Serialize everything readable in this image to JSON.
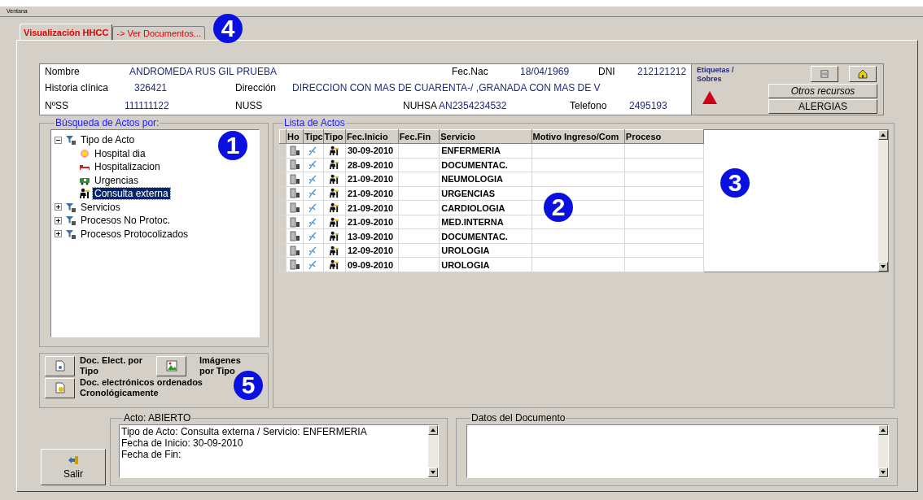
{
  "menu": [
    "Ventana"
  ],
  "tabs": [
    {
      "label": "Visualización HHCC",
      "selected": true
    },
    {
      "label": "-> Ver Documentos...",
      "selected": false
    }
  ],
  "patient": {
    "fields": [
      {
        "label": "Nombre",
        "value": "ANDROMEDA RUS GIL PRUEBA"
      },
      {
        "label": "Fec.Nac",
        "value": "18/04/1969"
      },
      {
        "label": "DNI",
        "value": "212121212"
      },
      {
        "label": "Historia clínica",
        "value": "326421"
      },
      {
        "label": "Dirección",
        "value": "DIRECCION CON MAS DE CUARENTA-/ ,GRANADA CON MAS DE V"
      },
      {
        "label": "NºSS",
        "value": "111111122"
      },
      {
        "label": "NUSS"
      },
      {
        "label": "NUHSA",
        "value": "AN2354234532"
      },
      {
        "label": "Telefono",
        "value": "2495193"
      }
    ]
  },
  "resources": {
    "labels_caption": "Etiquetas / Sobres",
    "other_button": "Otros recursos",
    "allergies_button": "ALERGIAS"
  },
  "search_tree": {
    "title": "Búsqueda de Actos por:",
    "items": [
      {
        "label": "Tipo de Acto",
        "kind": "filter",
        "expanded": true,
        "selected": false,
        "children": [
          {
            "label": "Hospital dia",
            "kind": "sun",
            "selected": false
          },
          {
            "label": "Hospitalizacion",
            "kind": "bed",
            "selected": false
          },
          {
            "label": "Urgencias",
            "kind": "ambulance",
            "selected": false
          },
          {
            "label": "Consulta externa",
            "kind": "doctor",
            "selected": true
          }
        ]
      },
      {
        "label": "Servicios",
        "kind": "filter",
        "expanded": false,
        "selected": false
      },
      {
        "label": "Procesos No Protoc.",
        "kind": "filter",
        "expanded": false,
        "selected": false
      },
      {
        "label": "Procesos Protocolizados",
        "kind": "filter",
        "expanded": false,
        "selected": false
      }
    ]
  },
  "doc_buttons": [
    {
      "label": "Doc. Elect. por Tipo",
      "kind": "doc"
    },
    {
      "label": "Imágenes por Tipo",
      "kind": "image"
    },
    {
      "label": "Doc. electrónicos ordenados Cronológicamente",
      "kind": "chrono"
    }
  ],
  "acts_list": {
    "title": "Lista de Actos",
    "columns": [
      "Ho",
      "Tipc",
      "Tipo",
      "Fec.Inicio",
      "Fec.Fin",
      "Servicio",
      "Motivo Ingreso/Com",
      "Proceso"
    ],
    "rows": [
      {
        "fec_inicio": "30-09-2010",
        "servicio": "ENFERMERIA"
      },
      {
        "fec_inicio": "28-09-2010",
        "servicio": "DOCUMENTAC."
      },
      {
        "fec_inicio": "21-09-2010",
        "servicio": "NEUMOLOGIA"
      },
      {
        "fec_inicio": "21-09-2010",
        "servicio": "URGENCIAS"
      },
      {
        "fec_inicio": "21-09-2010",
        "servicio": "CARDIOLOGIA"
      },
      {
        "fec_inicio": "21-09-2010",
        "servicio": "MED.INTERNA"
      },
      {
        "fec_inicio": "13-09-2010",
        "servicio": "DOCUMENTAC."
      },
      {
        "fec_inicio": "12-09-2010",
        "servicio": "UROLOGIA"
      },
      {
        "fec_inicio": "09-09-2010",
        "servicio": "UROLOGIA"
      }
    ]
  },
  "act": {
    "title": "Acto: ABIERTO",
    "lines": [
      "Tipo de Acto: Consulta externa / Servicio: ENFERMERIA",
      "Fecha de Inicio: 30-09-2010",
      "Fecha de Fin:"
    ]
  },
  "document": {
    "title": "Datos del Documento"
  },
  "exit_button": "Salir",
  "callouts": [
    {
      "label": "1"
    },
    {
      "label": "2"
    },
    {
      "label": "3"
    },
    {
      "label": "4"
    },
    {
      "label": "5"
    }
  ]
}
